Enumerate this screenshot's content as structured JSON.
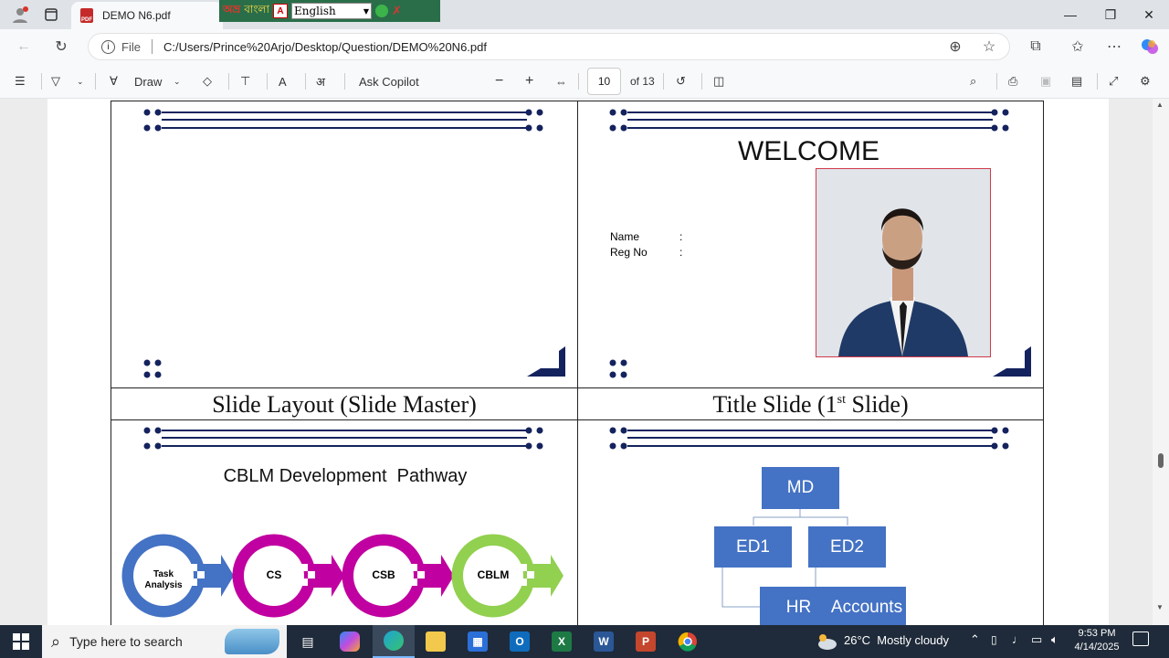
{
  "browser": {
    "tab_title": "DEMO N6.pdf",
    "ime_bengali_1": "অভ্র",
    "ime_bengali_2": "বাংলা",
    "ime_language": "English",
    "url_scheme_label": "File",
    "url": "C:/Users/Prince%20Arjo/Desktop/Question/DEMO%20N6.pdf"
  },
  "pdf_toolbar": {
    "draw_label": "Draw",
    "ask_copilot": "Ask Copilot",
    "page_current": "10",
    "page_total": "of 13"
  },
  "slides": {
    "layout_title": "Slide Layout (Slide Master)",
    "title_slide_title_main": "Title Slide (1",
    "title_slide_title_sup": "st",
    "title_slide_title_end": " Slide)",
    "welcome": "WELCOME",
    "name_label": "Name",
    "reg_label": "Reg No",
    "colon": ":",
    "cblm_heading": "CBLM Development  Pathway",
    "pathway": [
      "Task Analysis",
      "CS",
      "CSB",
      "CBLM"
    ],
    "org": {
      "md": "MD",
      "ed1": "ED1",
      "ed2": "ED2",
      "hr": "HR",
      "accounts": "Accounts"
    }
  },
  "taskbar": {
    "search_placeholder": "Type here to search",
    "weather": "26°C  Mostly cloudy",
    "time": "9:53 PM",
    "date": "4/14/2025"
  },
  "colors": {
    "navy": "#14235e",
    "org_blue": "#4472c4",
    "ring_blue": "#4472c4",
    "ring_magenta": "#c000a0",
    "ring_green": "#92d050"
  }
}
